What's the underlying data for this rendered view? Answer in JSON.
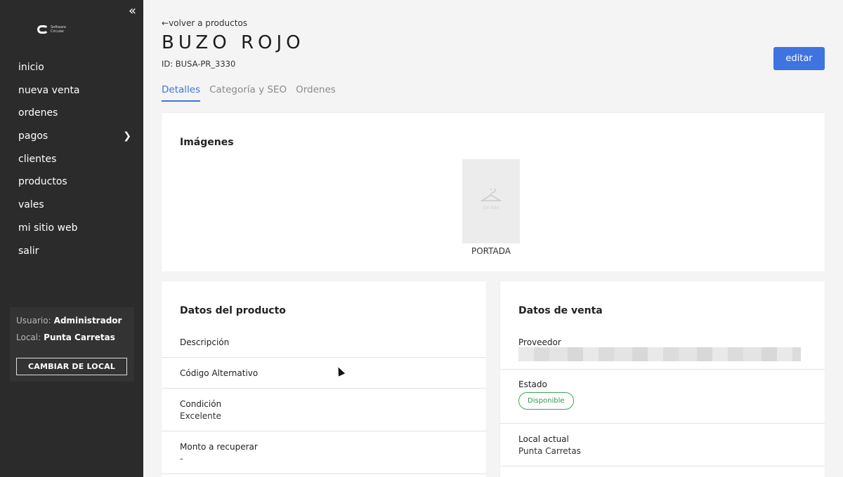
{
  "sidebar": {
    "logo_text": "Software Circular",
    "items": [
      {
        "label": "inicio"
      },
      {
        "label": "nueva venta"
      },
      {
        "label": "ordenes"
      },
      {
        "label": "pagos"
      },
      {
        "label": "clientes"
      },
      {
        "label": "productos"
      },
      {
        "label": "vales"
      },
      {
        "label": "mi sitio web"
      },
      {
        "label": "salir"
      }
    ],
    "user_label": "Usuario:",
    "user_value": "Administrador",
    "local_label": "Local:",
    "local_value": "Punta Carretas",
    "change_local": "CAMBIAR DE LOCAL"
  },
  "header": {
    "back_link": "volver a productos",
    "title": "BUZO ROJO",
    "id_text": "ID: BUSA-PR_3330",
    "edit_label": "editar"
  },
  "tabs": [
    {
      "label": "Detalles",
      "active": true
    },
    {
      "label": "Categoría y SEO",
      "active": false
    },
    {
      "label": "Ordenes",
      "active": false
    }
  ],
  "images": {
    "title": "Imágenes",
    "placeholder_text": "sin foto",
    "caption": "PORTADA"
  },
  "product_data": {
    "title": "Datos del producto",
    "fields": [
      {
        "label": "Descripción",
        "value": ""
      },
      {
        "label": "Código Alternativo",
        "value": ""
      },
      {
        "label": "Condición",
        "value": "Excelente"
      },
      {
        "label": "Monto a recuperar",
        "value": "-"
      }
    ]
  },
  "sale_data": {
    "title": "Datos de venta",
    "proveedor_label": "Proveedor",
    "estado_label": "Estado",
    "estado_badge": "Disponible",
    "local_label": "Local actual",
    "local_value": "Punta Carretas"
  },
  "colors": {
    "accent": "#3f73e0",
    "sidebar_bg": "#2b2b2b",
    "status_green": "#3aa655"
  }
}
